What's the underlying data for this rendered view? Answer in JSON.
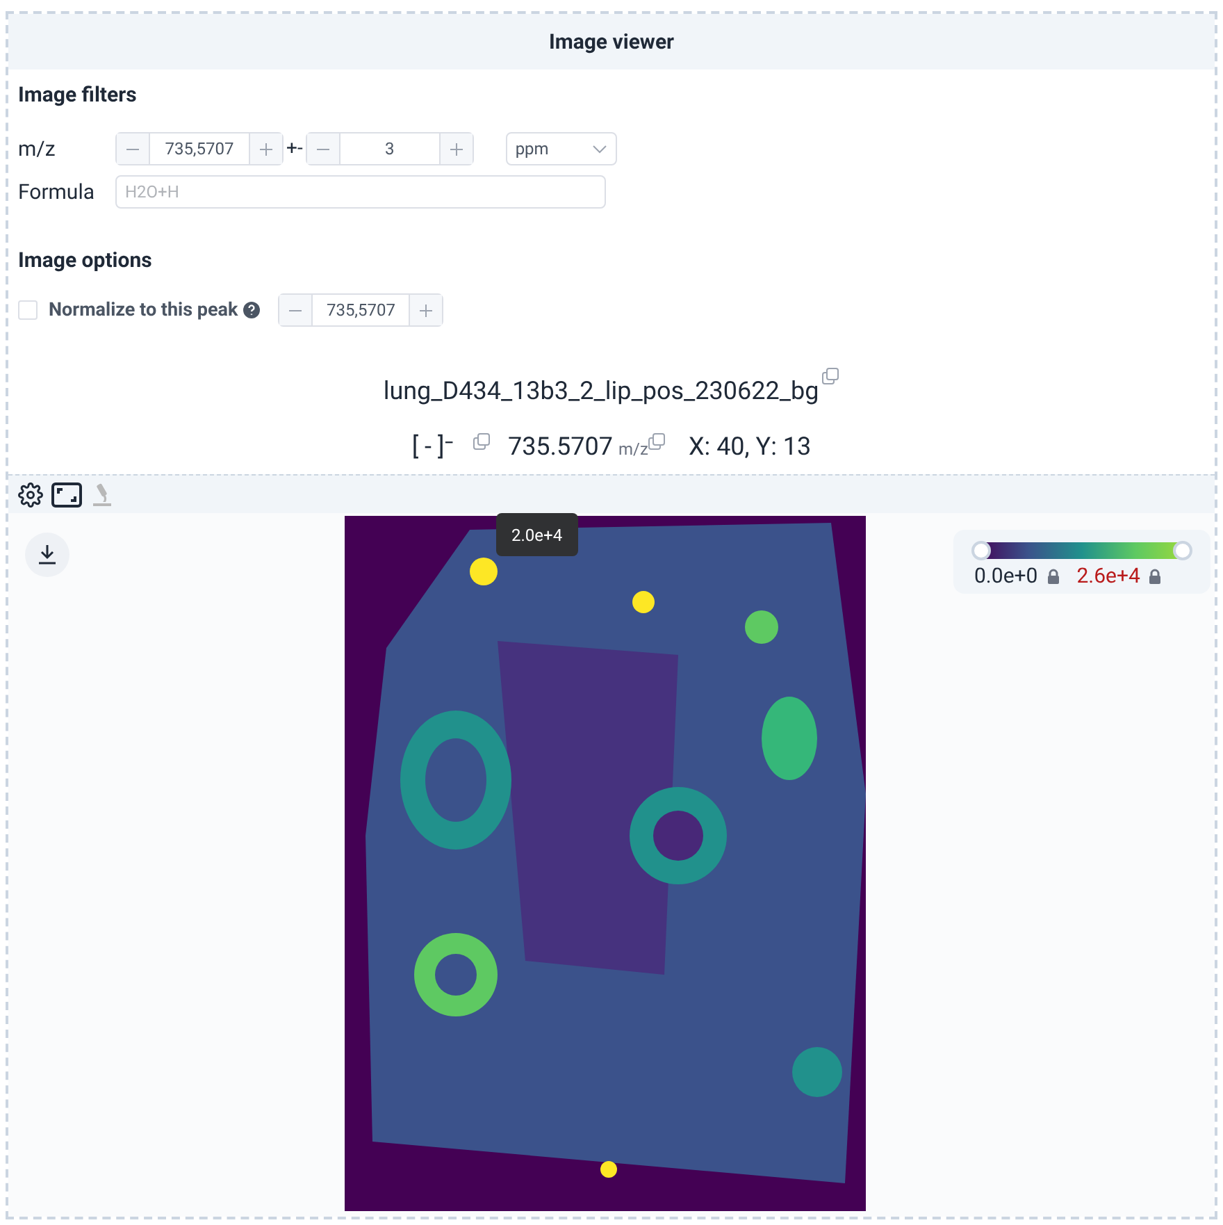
{
  "title": "Image viewer",
  "filters": {
    "heading": "Image filters",
    "mz": {
      "label": "m/z",
      "value": "735,5707",
      "sep": "+-",
      "tolerance": "3",
      "unit": "ppm"
    },
    "formula": {
      "label": "Formula",
      "placeholder": "H2O+H"
    }
  },
  "options": {
    "heading": "Image options",
    "normalize": {
      "label": "Normalize to this peak",
      "checked": false,
      "value": "735,5707"
    }
  },
  "dataset": "lung_D434_13b3_2_lip_pos_230622_bg",
  "info": {
    "ion": "[ - ]⁻",
    "mz": "735.5707",
    "mz_unit": "m/z",
    "coords": "X: 40, Y: 13"
  },
  "tooltip": "2.0e+4",
  "colorbar": {
    "min": {
      "label": "0.0e+0",
      "level": 0
    },
    "max": {
      "label": "2.6e+4",
      "level": 1
    }
  }
}
